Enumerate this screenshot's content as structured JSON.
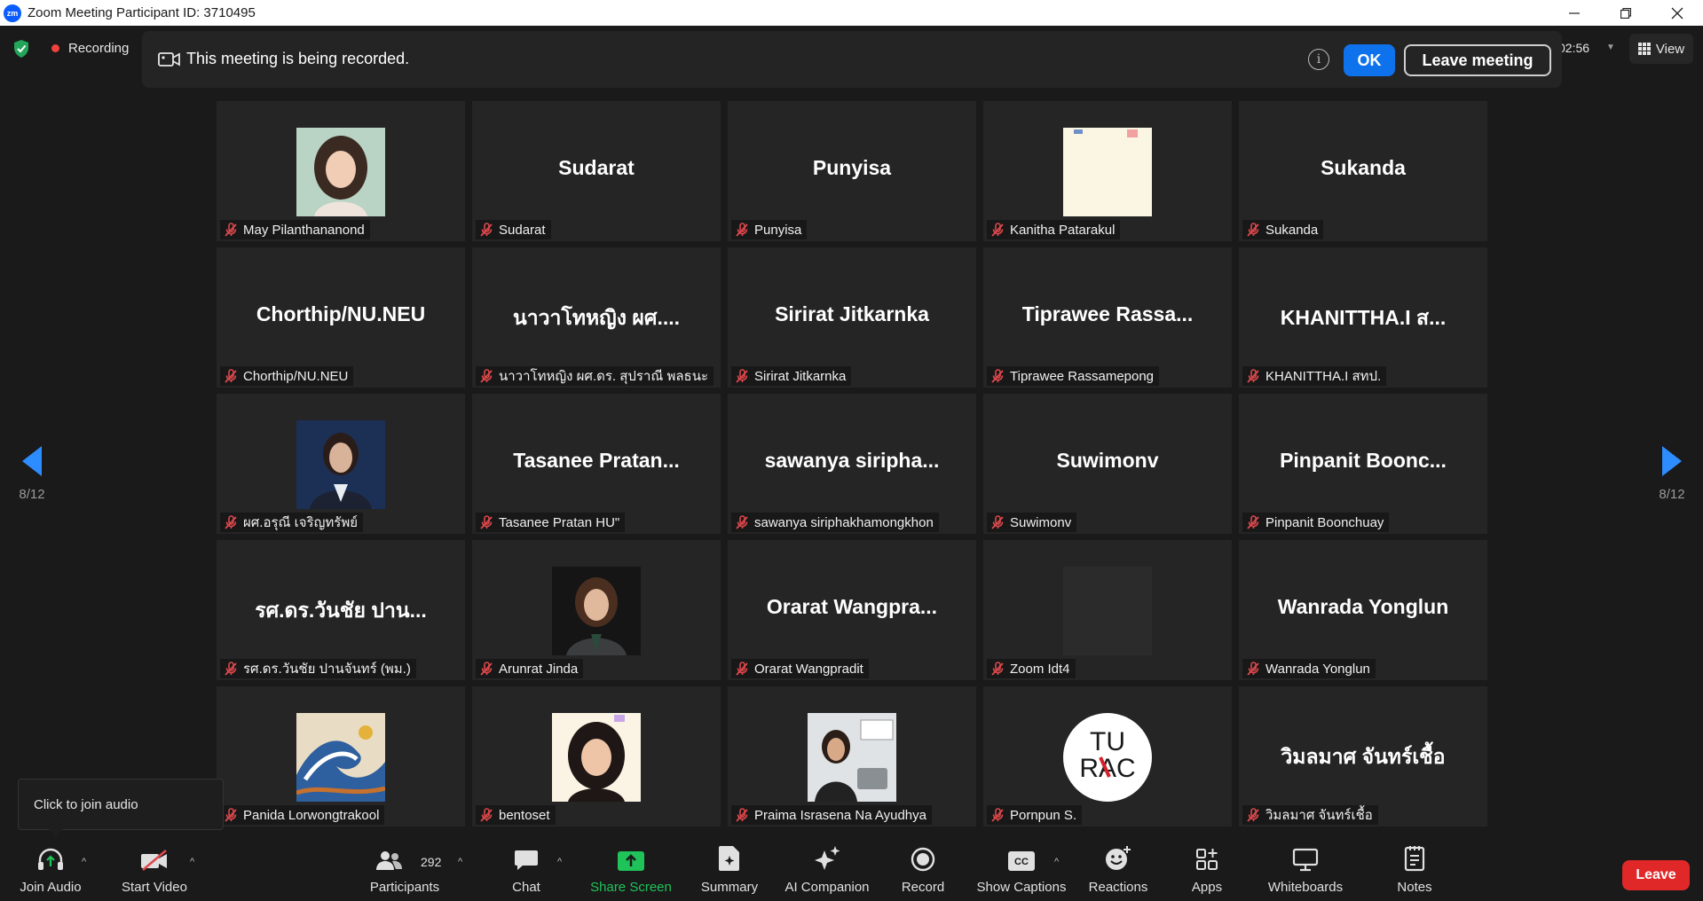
{
  "window": {
    "title": "Zoom Meeting Participant ID: 3710495",
    "logo": "zm"
  },
  "topbar": {
    "recording_label": "Recording",
    "timer": "02:56",
    "view_label": "View"
  },
  "banner": {
    "text": "This meeting is being recorded.",
    "ok_label": "OK",
    "leave_label": "Leave meeting"
  },
  "gallery": {
    "page_left": "8/12",
    "page_right": "8/12",
    "tiles": [
      {
        "big": "",
        "label": "May Pilanthananond",
        "avatar": "photo-woman-green"
      },
      {
        "big": "Sudarat",
        "label": "Sudarat"
      },
      {
        "big": "Punyisa",
        "label": "Punyisa"
      },
      {
        "big": "",
        "label": "Kanitha Patarakul",
        "avatar": "photo-cream"
      },
      {
        "big": "Sukanda",
        "label": "Sukanda"
      },
      {
        "big": "Chorthip/NU.NEU",
        "label": "Chorthip/NU.NEU"
      },
      {
        "big": "นาวาโทหญิง ผศ....",
        "label": "นาวาโทหญิง ผศ.ดร. สุปราณี พลธนะ"
      },
      {
        "big": "Sirirat Jitkarnka",
        "label": "Sirirat Jitkarnka"
      },
      {
        "big": "Tiprawee  Rassa...",
        "label": "Tiprawee Rassamepong"
      },
      {
        "big": "KHANITTHA.I ส...",
        "label": "KHANITTHA.I สทป."
      },
      {
        "big": "",
        "label": "ผศ.อรุณี เจริญทรัพย์",
        "avatar": "photo-woman-navy"
      },
      {
        "big": "Tasanee  Pratan...",
        "label": "Tasanee Pratan HU\""
      },
      {
        "big": "sawanya  siripha...",
        "label": "sawanya siriphakhamongkhon"
      },
      {
        "big": "Suwimonv",
        "label": "Suwimonv"
      },
      {
        "big": "Pinpanit  Boonc...",
        "label": "Pinpanit Boonchuay"
      },
      {
        "big": "รศ.ดร.วันชัย ปาน...",
        "label": "รศ.ดร.วันชัย ปานจันทร์ (พม.)"
      },
      {
        "big": "",
        "label": "Arunrat Jinda",
        "avatar": "photo-woman-dark"
      },
      {
        "big": "Orarat  Wangpra...",
        "label": "Orarat Wangpradit"
      },
      {
        "big": "",
        "label": "Zoom Idt4",
        "avatar": "blank"
      },
      {
        "big": "Wanrada Yonglun",
        "label": "Wanrada Yonglun"
      },
      {
        "big": "",
        "label": "Panida Lorwongtrakool",
        "avatar": "painting-wave"
      },
      {
        "big": "",
        "label": "bentoset",
        "avatar": "photo-woman-smile"
      },
      {
        "big": "",
        "label": "Praima Israsena Na Ayudhya",
        "avatar": "photo-woman-office"
      },
      {
        "big": "",
        "label": "Pornpun S.",
        "avatar": "tu-rac-logo"
      },
      {
        "big": "วิมลมาศ จันทร์เชื้อ",
        "label": "วิมลมาศ จันทร์เชื้อ"
      }
    ]
  },
  "tooltip": {
    "text": "Click to join audio"
  },
  "toolbar": {
    "join_audio": "Join Audio",
    "start_video": "Start Video",
    "participants": "Participants",
    "participants_count": "292",
    "chat": "Chat",
    "share_screen": "Share Screen",
    "summary": "Summary",
    "ai_companion": "AI Companion",
    "record": "Record",
    "show_captions": "Show Captions",
    "reactions": "Reactions",
    "apps": "Apps",
    "whiteboards": "Whiteboards",
    "notes": "Notes",
    "leave": "Leave"
  },
  "colors": {
    "accent": "#0e72ed",
    "share_green": "#20c35a",
    "leave_red": "#e02828",
    "mute_red": "#e0484c",
    "arrow_blue": "#2d8cff"
  },
  "avatar_logo_text": {
    "line1": "TU",
    "line2": "RAC"
  }
}
